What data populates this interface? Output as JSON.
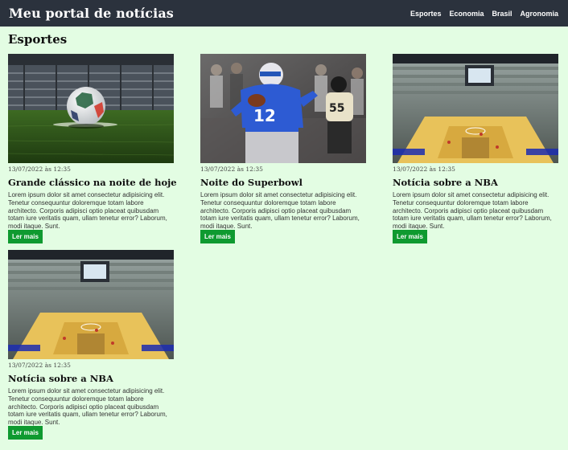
{
  "header": {
    "brand": "Meu portal de notícias",
    "nav": [
      "Esportes",
      "Economia",
      "Brasil",
      "Agronomia"
    ]
  },
  "section_title": "Esportes",
  "articles": [
    {
      "date": "13/07/2022 às 12:35",
      "title": "Grande clássico na noite de hoje",
      "excerpt": "Lorem ipsum dolor sit amet consectetur adipisicing elit. Tenetur consequuntur doloremque totam labore architecto. Corporis adipisci optio placeat quibusdam totam iure veritatis quam, ullam tenetur error? Laborum, modi itaque. Sunt.",
      "button": "Ler mais",
      "image": "soccer-ball-stadium-photo"
    },
    {
      "date": "13/07/2022 às 12:35",
      "title": "Noite do Superbowl",
      "excerpt": "Lorem ipsum dolor sit amet consectetur adipisicing elit. Tenetur consequuntur doloremque totam labore architecto. Corporis adipisci optio placeat quibusdam totam iure veritatis quam, ullam tenetur error? Laborum, modi itaque. Sunt.",
      "button": "Ler mais",
      "image": "american-football-player-photo"
    },
    {
      "date": "13/07/2022 às 12:35",
      "title": "Notícia sobre a NBA",
      "excerpt": "Lorem ipsum dolor sit amet consectetur adipisicing elit. Tenetur consequuntur doloremque totam labore architecto. Corporis adipisci optio placeat quibusdam totam iure veritatis quam, ullam tenetur error? Laborum, modi itaque. Sunt.",
      "button": "Ler mais",
      "image": "basketball-arena-photo"
    },
    {
      "date": "13/07/2022 às 12:35",
      "title": "Notícia sobre a NBA",
      "excerpt": "Lorem ipsum dolor sit amet consectetur adipisicing elit. Tenetur consequuntur doloremque totam labore architecto. Corporis adipisci optio placeat quibusdam totam iure veritatis quam, ullam tenetur error? Laborum, modi itaque. Sunt.",
      "button": "Ler mais",
      "image": "basketball-arena-photo"
    }
  ],
  "colors": {
    "header_bg": "#2b323d",
    "page_bg": "#e3fde3",
    "button_bg": "#0f9a30"
  }
}
